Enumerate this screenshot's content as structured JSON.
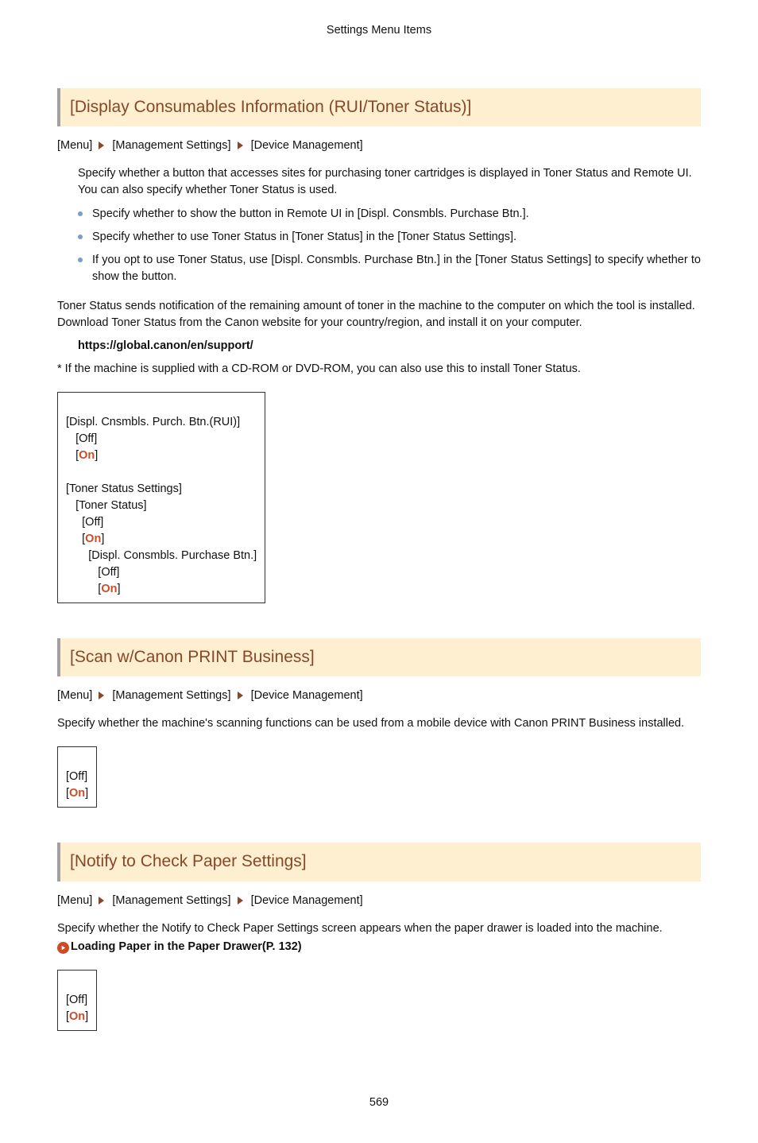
{
  "header": {
    "running_title": "Settings Menu Items"
  },
  "section1": {
    "title": "[Display Consumables Information (RUI/Toner Status)]",
    "breadcrumb": [
      "[Menu]",
      "[Management Settings]",
      "[Device Management]"
    ],
    "intro": "Specify whether a button that accesses sites for purchasing toner cartridges is displayed in Toner Status and Remote UI. You can also specify whether Toner Status is used.",
    "bullets": [
      "Specify whether to show the button in Remote UI in [Displ. Consmbls. Purchase Btn.].",
      "Specify whether to use Toner Status in [Toner Status] in the [Toner Status Settings].",
      "If you opt to use Toner Status, use [Displ. Consmbls. Purchase Btn.] in the [Toner Status Settings] to specify whether to show the button."
    ],
    "after_text": "Toner Status sends notification of the remaining amount of toner in the machine to the computer on which the tool is installed. Download Toner Status from the Canon website for your country/region, and install it on your computer.",
    "support_url": "https://global.canon/en/support/",
    "cdrom_note": "* If the machine is supplied with a CD-ROM or DVD-ROM, you can also use this to install Toner Status.",
    "option_tree": {
      "l1": "[Displ. Cnsmbls. Purch. Btn.(RUI)]",
      "l1_off": "[Off]",
      "l1_on": "On",
      "l2": "[Toner Status Settings]",
      "l2a": "[Toner Status]",
      "l2a_off": "[Off]",
      "l2a_on": "On",
      "l3": "[Displ. Consmbls. Purchase Btn.]",
      "l3_off": "[Off]",
      "l3_on": "On"
    }
  },
  "section2": {
    "title": "[Scan w/Canon PRINT Business]",
    "breadcrumb": [
      "[Menu]",
      "[Management Settings]",
      "[Device Management]"
    ],
    "para": "Specify whether the machine's scanning functions can be used from a mobile device with Canon PRINT Business installed.",
    "options": {
      "off": "[Off]",
      "on": "On"
    }
  },
  "section3": {
    "title": "[Notify to Check Paper Settings]",
    "breadcrumb": [
      "[Menu]",
      "[Management Settings]",
      "[Device Management]"
    ],
    "para": "Specify whether the Notify to Check Paper Settings screen appears when the paper drawer is loaded into the machine.",
    "xref": "Loading Paper in the Paper Drawer(P. 132)",
    "options": {
      "off": "[Off]",
      "on": "On"
    }
  },
  "page_number": "569"
}
